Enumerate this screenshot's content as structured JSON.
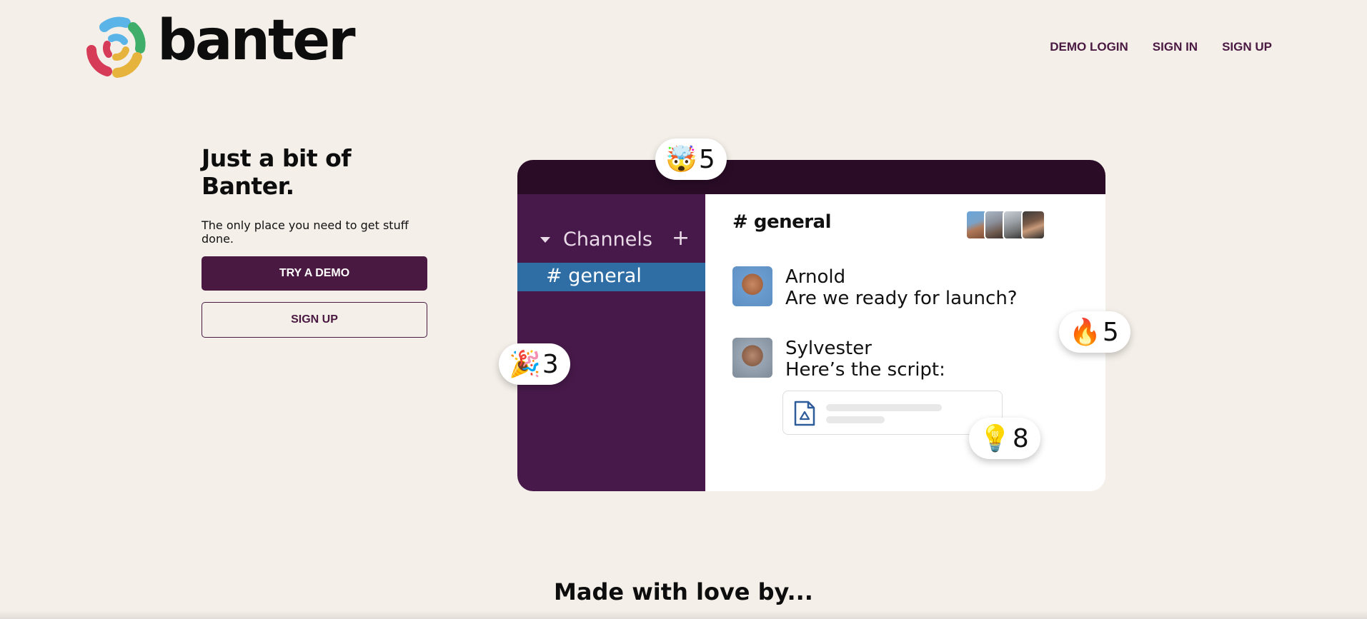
{
  "brand": {
    "name": "banter"
  },
  "nav": {
    "demo_login": "DEMO LOGIN",
    "sign_in": "SIGN IN",
    "sign_up": "SIGN UP"
  },
  "hero": {
    "title": "Just a bit of Banter.",
    "subtitle": "The only place you need to get stuff done.",
    "try_demo": "TRY A DEMO",
    "sign_up": "SIGN UP"
  },
  "mockup": {
    "sidebar": {
      "section_label": "Channels",
      "channel": "# general"
    },
    "channel_title": "# general",
    "messages": [
      {
        "author": "Arnold",
        "text": "Are we ready for launch?"
      },
      {
        "author": "Sylvester",
        "text": "Here’s the script:"
      }
    ],
    "reactions": [
      {
        "emoji": "🤯",
        "count": "5"
      },
      {
        "emoji": "🎉",
        "count": "3"
      },
      {
        "emoji": "🔥",
        "count": "5"
      },
      {
        "emoji": "💡",
        "count": "8"
      }
    ]
  },
  "footer": {
    "made_with": "Made with love by..."
  },
  "colors": {
    "background": "#f4efe9",
    "brand_purple": "#4a1942",
    "sidebar": "#47194a",
    "topbar": "#2a0c27",
    "active_channel": "#2f6ea5"
  }
}
